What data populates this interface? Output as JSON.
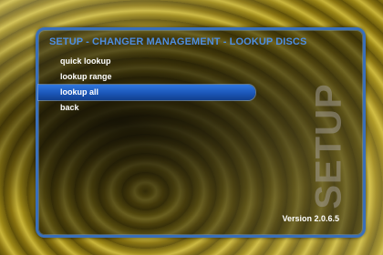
{
  "header": {
    "title": "SETUP - CHANGER MANAGEMENT - LOOKUP DISCS"
  },
  "menu": {
    "items": [
      {
        "label": "quick lookup",
        "selected": false
      },
      {
        "label": "lookup range",
        "selected": false
      },
      {
        "label": "lookup all",
        "selected": true
      },
      {
        "label": "back",
        "selected": false
      }
    ]
  },
  "side_label": "SETUP",
  "footer": {
    "version": "Version 2.0.6.5"
  },
  "colors": {
    "accent": "#3a6fb8",
    "title": "#4f8ee0",
    "selection": "#1b56b8",
    "background": "#8a7410"
  }
}
